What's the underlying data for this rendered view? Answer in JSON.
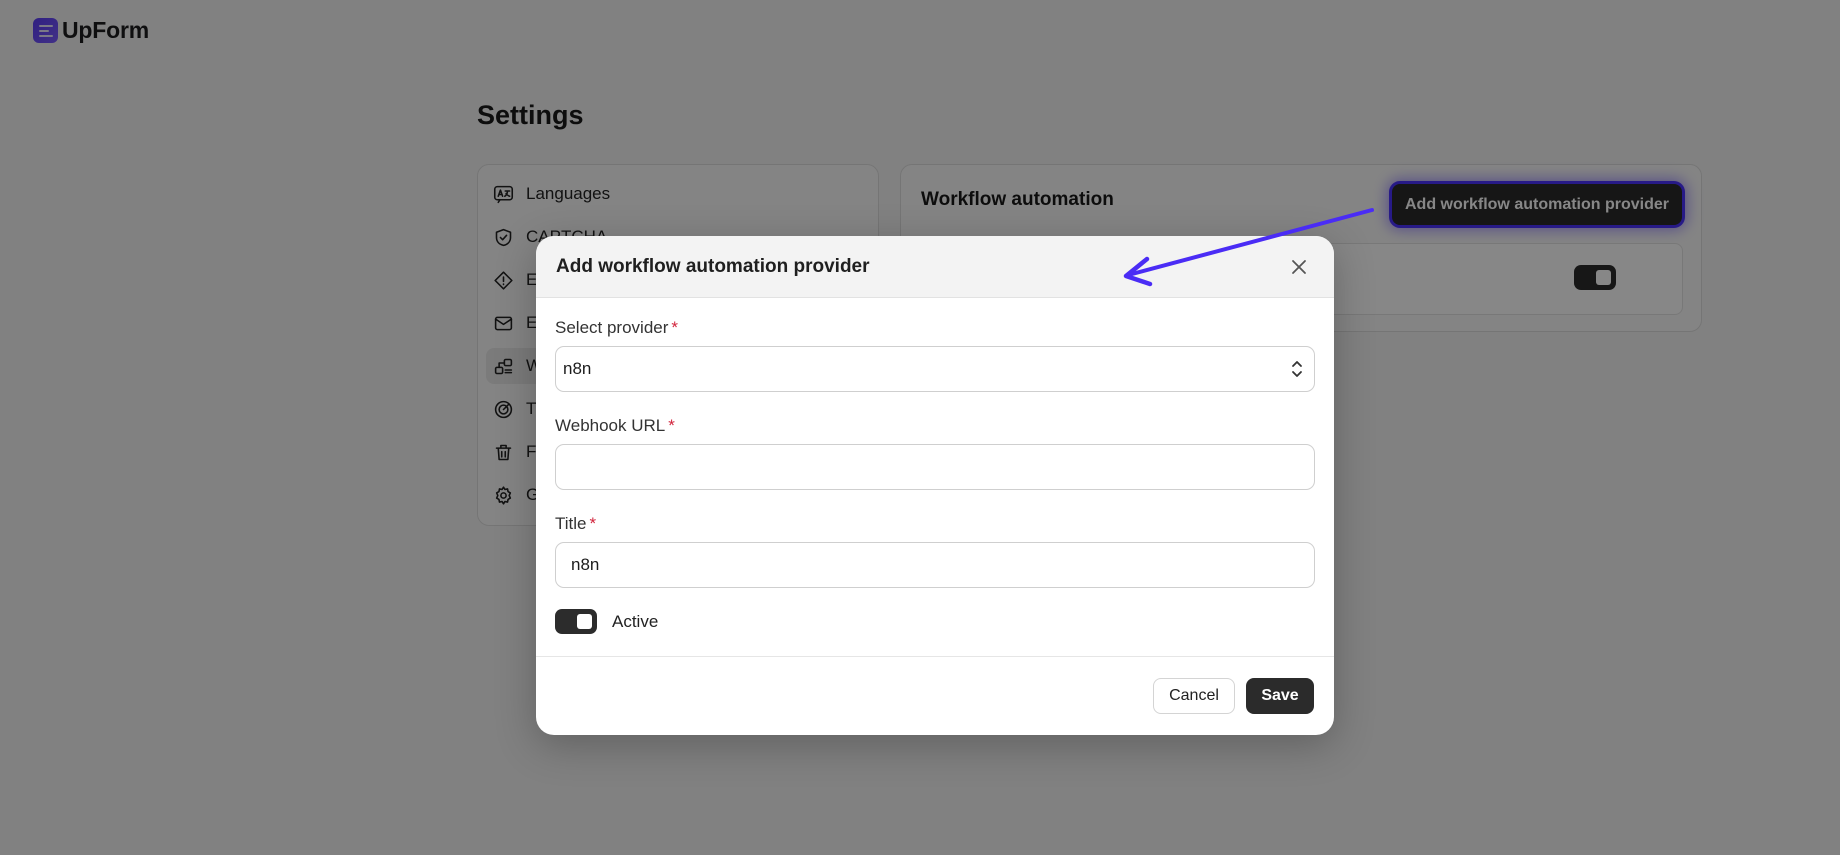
{
  "app": {
    "name": "UpForm",
    "brand_color": "#5b3df5"
  },
  "page": {
    "title": "Settings"
  },
  "settings_nav": {
    "items": [
      {
        "label": "Languages",
        "icon": "languages-icon"
      },
      {
        "label": "CAPTCHA",
        "icon": "shield-check-icon"
      },
      {
        "label": "E",
        "icon": "diamond-alert-icon"
      },
      {
        "label": "E",
        "icon": "mail-icon"
      },
      {
        "label": "W",
        "icon": "workflow-icon",
        "active": true
      },
      {
        "label": "T",
        "icon": "target-icon"
      },
      {
        "label": "F",
        "icon": "trash-icon"
      },
      {
        "label": "G",
        "icon": "gear-icon"
      }
    ]
  },
  "workflow_card": {
    "title": "Workflow automation",
    "add_button_label": "Add workflow automation provider",
    "highlight_color": "#4a32ff"
  },
  "modal": {
    "title": "Add workflow automation provider",
    "fields": {
      "provider": {
        "label": "Select provider",
        "required_mark": "*",
        "value": "n8n"
      },
      "webhook": {
        "label": "Webhook URL",
        "required_mark": "*",
        "value": ""
      },
      "title": {
        "label": "Title",
        "required_mark": "*",
        "value": "n8n"
      }
    },
    "active_label": "Active",
    "cancel_label": "Cancel",
    "save_label": "Save"
  }
}
